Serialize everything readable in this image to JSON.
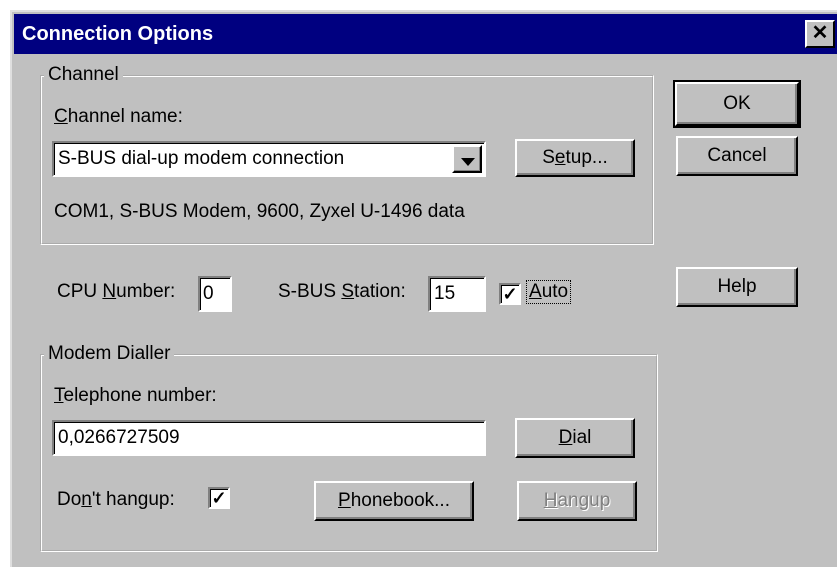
{
  "title": "Connection Options",
  "close_glyph": "✕",
  "channel_group": {
    "legend": "Channel",
    "name_label_prefix": "C",
    "name_label_rest": "hannel name:",
    "selected_channel": "S-BUS dial-up modem connection",
    "setup_button_pre": "S",
    "setup_button_mn": "e",
    "setup_button_post": "tup...",
    "details": "COM1, S-BUS Modem, 9600, Zyxel U-1496 data"
  },
  "cpu_label_pre": "CPU ",
  "cpu_label_mn": "N",
  "cpu_label_post": "umber:",
  "cpu_number": "0",
  "station_label_pre": "S-BUS ",
  "station_label_mn": "S",
  "station_label_post": "tation:",
  "station_value": "15",
  "auto_checked_glyph": "✓",
  "auto_label_mn": "A",
  "auto_label_rest": "uto",
  "modem_group": {
    "legend": "Modem Dialler",
    "phone_label_mn": "T",
    "phone_label_rest": "elephone number:",
    "phone_value": "0,0266727509",
    "dial_button_mn": "D",
    "dial_button_rest": "ial",
    "hangup_label_pre": "Do",
    "hangup_label_mn": "n",
    "hangup_label_post": "'t hangup:",
    "hangup_checked_glyph": "✓",
    "phonebook_button_mn": "P",
    "phonebook_button_rest": "honebook...",
    "hangup_button_mn": "H",
    "hangup_button_rest": "angup"
  },
  "buttons": {
    "ok": "OK",
    "cancel": "Cancel",
    "help": "Help"
  }
}
